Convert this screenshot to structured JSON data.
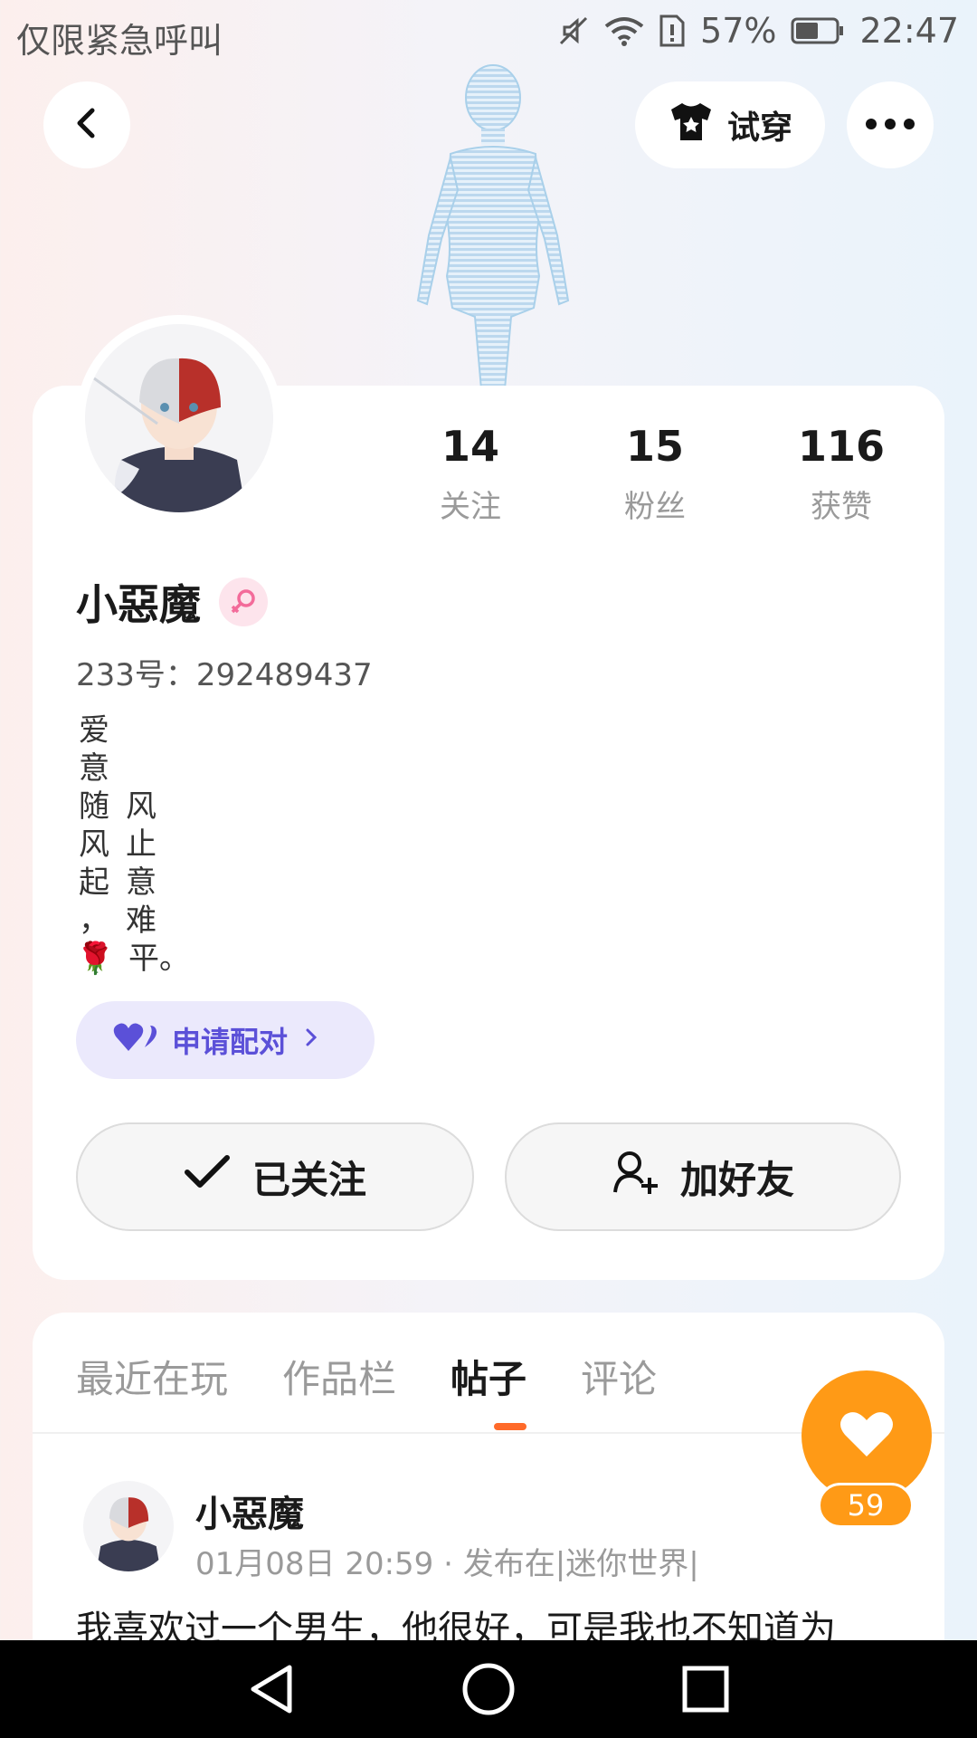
{
  "status_bar": {
    "carrier": "仅限紧急呼叫",
    "battery_percent": "57%",
    "time": "22:47",
    "icons": [
      "mute-icon",
      "wifi-icon",
      "sim-alert-icon",
      "battery-icon"
    ]
  },
  "top_bar": {
    "back_icon": "chevron-left-icon",
    "tryon_label": "试穿",
    "tryon_icon": "tshirt-icon",
    "more_icon": "more-dots-icon"
  },
  "profile": {
    "stats": [
      {
        "value": "14",
        "label": "关注"
      },
      {
        "value": "15",
        "label": "粉丝"
      },
      {
        "value": "116",
        "label": "获赞"
      }
    ],
    "username": "小惡魔",
    "gender_icon": "female-icon",
    "id_label": "233号：",
    "id_value": "292489437",
    "bio_col1": [
      "爱",
      "意",
      "随",
      "风",
      "起",
      "，"
    ],
    "bio_col2": [
      "风",
      "止",
      "意",
      "难",
      "平。"
    ],
    "bio_emoji": "🌹",
    "pair_label": "申请配对",
    "followed_label": "已关注",
    "add_friend_label": "加好友"
  },
  "tabs": {
    "items": [
      "最近在玩",
      "作品栏",
      "帖子",
      "评论"
    ],
    "active": "帖子"
  },
  "post": {
    "author": "小惡魔",
    "meta": "01月08日 20:59 · 发布在|迷你世界|",
    "text": "我喜欢过一个男生，他很好，可是我也不知道为"
  },
  "like": {
    "count": "59",
    "color": "#ff9a16"
  },
  "colors": {
    "accent_orange": "#ff6a2a",
    "pair_purple": "#5b50d8"
  }
}
